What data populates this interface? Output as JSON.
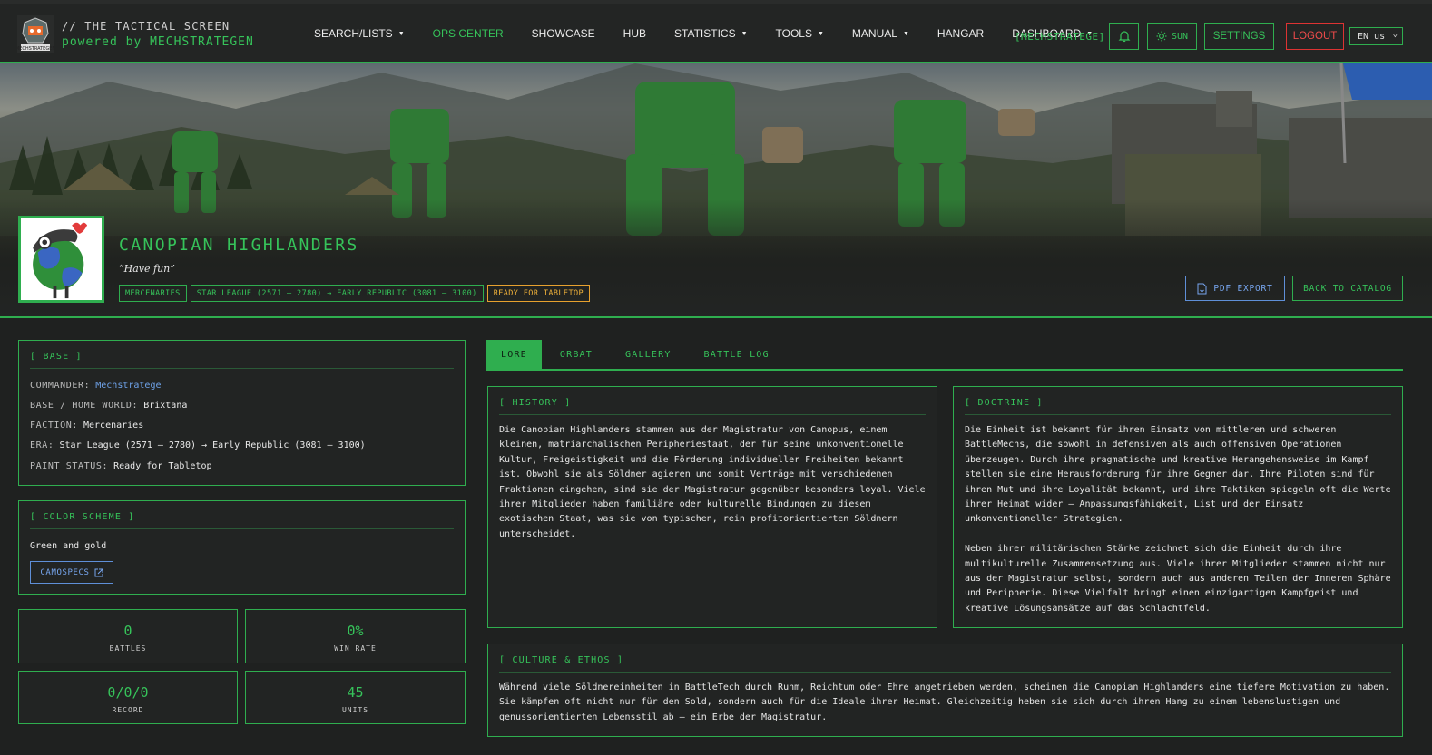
{
  "nav": {
    "brand_line1": "// THE TACTICAL SCREEN",
    "brand_line2": "powered by MECHSTRATEGEN",
    "items": [
      {
        "label": "SEARCH/LISTS",
        "dropdown": true
      },
      {
        "label": "OPS CENTER",
        "dropdown": false,
        "active": true
      },
      {
        "label": "SHOWCASE",
        "dropdown": false
      },
      {
        "label": "HUB",
        "dropdown": false
      },
      {
        "label": "STATISTICS",
        "dropdown": true
      },
      {
        "label": "TOOLS",
        "dropdown": true
      },
      {
        "label": "MANUAL",
        "dropdown": true
      },
      {
        "label": "HANGAR",
        "dropdown": false
      },
      {
        "label": "DASHBOARD",
        "dropdown": true
      }
    ],
    "user_tag": "[MECHSTRATEGE]",
    "theme_label": "SUN",
    "settings_label": "SETTINGS",
    "logout_label": "LOGOUT",
    "language": "EN us",
    "accent": "#2fae4f",
    "danger": "#e23b3b"
  },
  "hero": {
    "title": "CANOPIAN HIGHLANDERS",
    "motto": "“Have fun”",
    "tags": [
      "MERCENARIES",
      "STAR LEAGUE (2571 – 2780) → EARLY REPUBLIC (3081 – 3100)",
      "READY FOR TABLETOP"
    ],
    "pdf_export_label": "PDF EXPORT",
    "back_label": "BACK TO CATALOG"
  },
  "base": {
    "heading": "[ BASE ]",
    "commander_key": "COMMANDER:",
    "commander_value": "Mechstratege",
    "homeworld_key": "BASE / HOME WORLD:",
    "homeworld_value": "Brixtana",
    "faction_key": "FACTION:",
    "faction_value": "Mercenaries",
    "era_key": "ERA:",
    "era_value": "Star League (2571 – 2780) → Early Republic (3081 – 3100)",
    "paint_key": "PAINT STATUS:",
    "paint_value": "Ready for Tabletop"
  },
  "color_scheme": {
    "heading": "[ COLOR SCHEME ]",
    "value": "Green and gold",
    "camospecs_label": "CAMOSPECS"
  },
  "stats": [
    {
      "value": "0",
      "label": "BATTLES"
    },
    {
      "value": "0%",
      "label": "WIN RATE"
    },
    {
      "value": "0/0/0",
      "label": "RECORD"
    },
    {
      "value": "45",
      "label": "UNITS"
    }
  ],
  "tabs": [
    {
      "label": "LORE",
      "active": true
    },
    {
      "label": "ORBAT",
      "active": false
    },
    {
      "label": "GALLERY",
      "active": false
    },
    {
      "label": "BATTLE LOG",
      "active": false
    }
  ],
  "history": {
    "heading": "[ HISTORY ]",
    "lines": [
      "Die Canopian Highlanders stammen aus der Magistratur von Canopus, einem",
      "kleinen, matriarchalischen Peripheriestaat, der für seine unkonventionelle",
      "Kultur, Freigeistigkeit und die Förderung individueller Freiheiten bekannt",
      "ist. Obwohl sie als Söldner agieren und somit Verträge mit verschiedenen",
      "Fraktionen eingehen, sind sie der Magistratur gegenüber besonders loyal. Viele",
      "ihrer Mitglieder haben familiäre oder kulturelle Bindungen zu diesem",
      "exotischen Staat, was sie von typischen, rein profitorientierten Söldnern",
      "unterscheidet."
    ]
  },
  "doctrine": {
    "heading": "[ DOCTRINE ]",
    "lines": [
      "Die Einheit ist bekannt für ihren Einsatz von mittleren und schweren",
      "BattleMechs, die sowohl in defensiven als auch offensiven Operationen",
      "überzeugen. Durch ihre pragmatische und kreative Herangehensweise im Kampf",
      "stellen sie eine Herausforderung für ihre Gegner dar. Ihre Piloten sind für",
      "ihren Mut und ihre Loyalität bekannt, und ihre Taktiken spiegeln oft die Werte",
      "ihrer Heimat wider – Anpassungsfähigkeit, List und der Einsatz",
      "unkonventioneller Strategien.",
      "",
      "Neben ihrer militärischen Stärke zeichnet sich die Einheit durch ihre",
      "multikulturelle Zusammensetzung aus. Viele ihrer Mitglieder stammen nicht nur",
      "aus der Magistratur selbst, sondern auch aus anderen Teilen der Inneren Sphäre",
      "und Peripherie. Diese Vielfalt bringt einen einzigartigen Kampfgeist und",
      "kreative Lösungsansätze auf das Schlachtfeld."
    ]
  },
  "culture": {
    "heading": "[ CULTURE & ETHOS ]",
    "lines": [
      "Während viele Söldnereinheiten in BattleTech durch Ruhm, Reichtum oder Ehre angetrieben werden, scheinen die Canopian Highlanders eine tiefere Motivation zu haben.",
      "Sie kämpfen oft nicht nur für den Sold, sondern auch für die Ideale ihrer Heimat. Gleichzeitig heben sie sich durch ihren Hang zu einem lebenslustigen und",
      "genussorientierten Lebensstil ab – ein Erbe der Magistratur."
    ]
  }
}
